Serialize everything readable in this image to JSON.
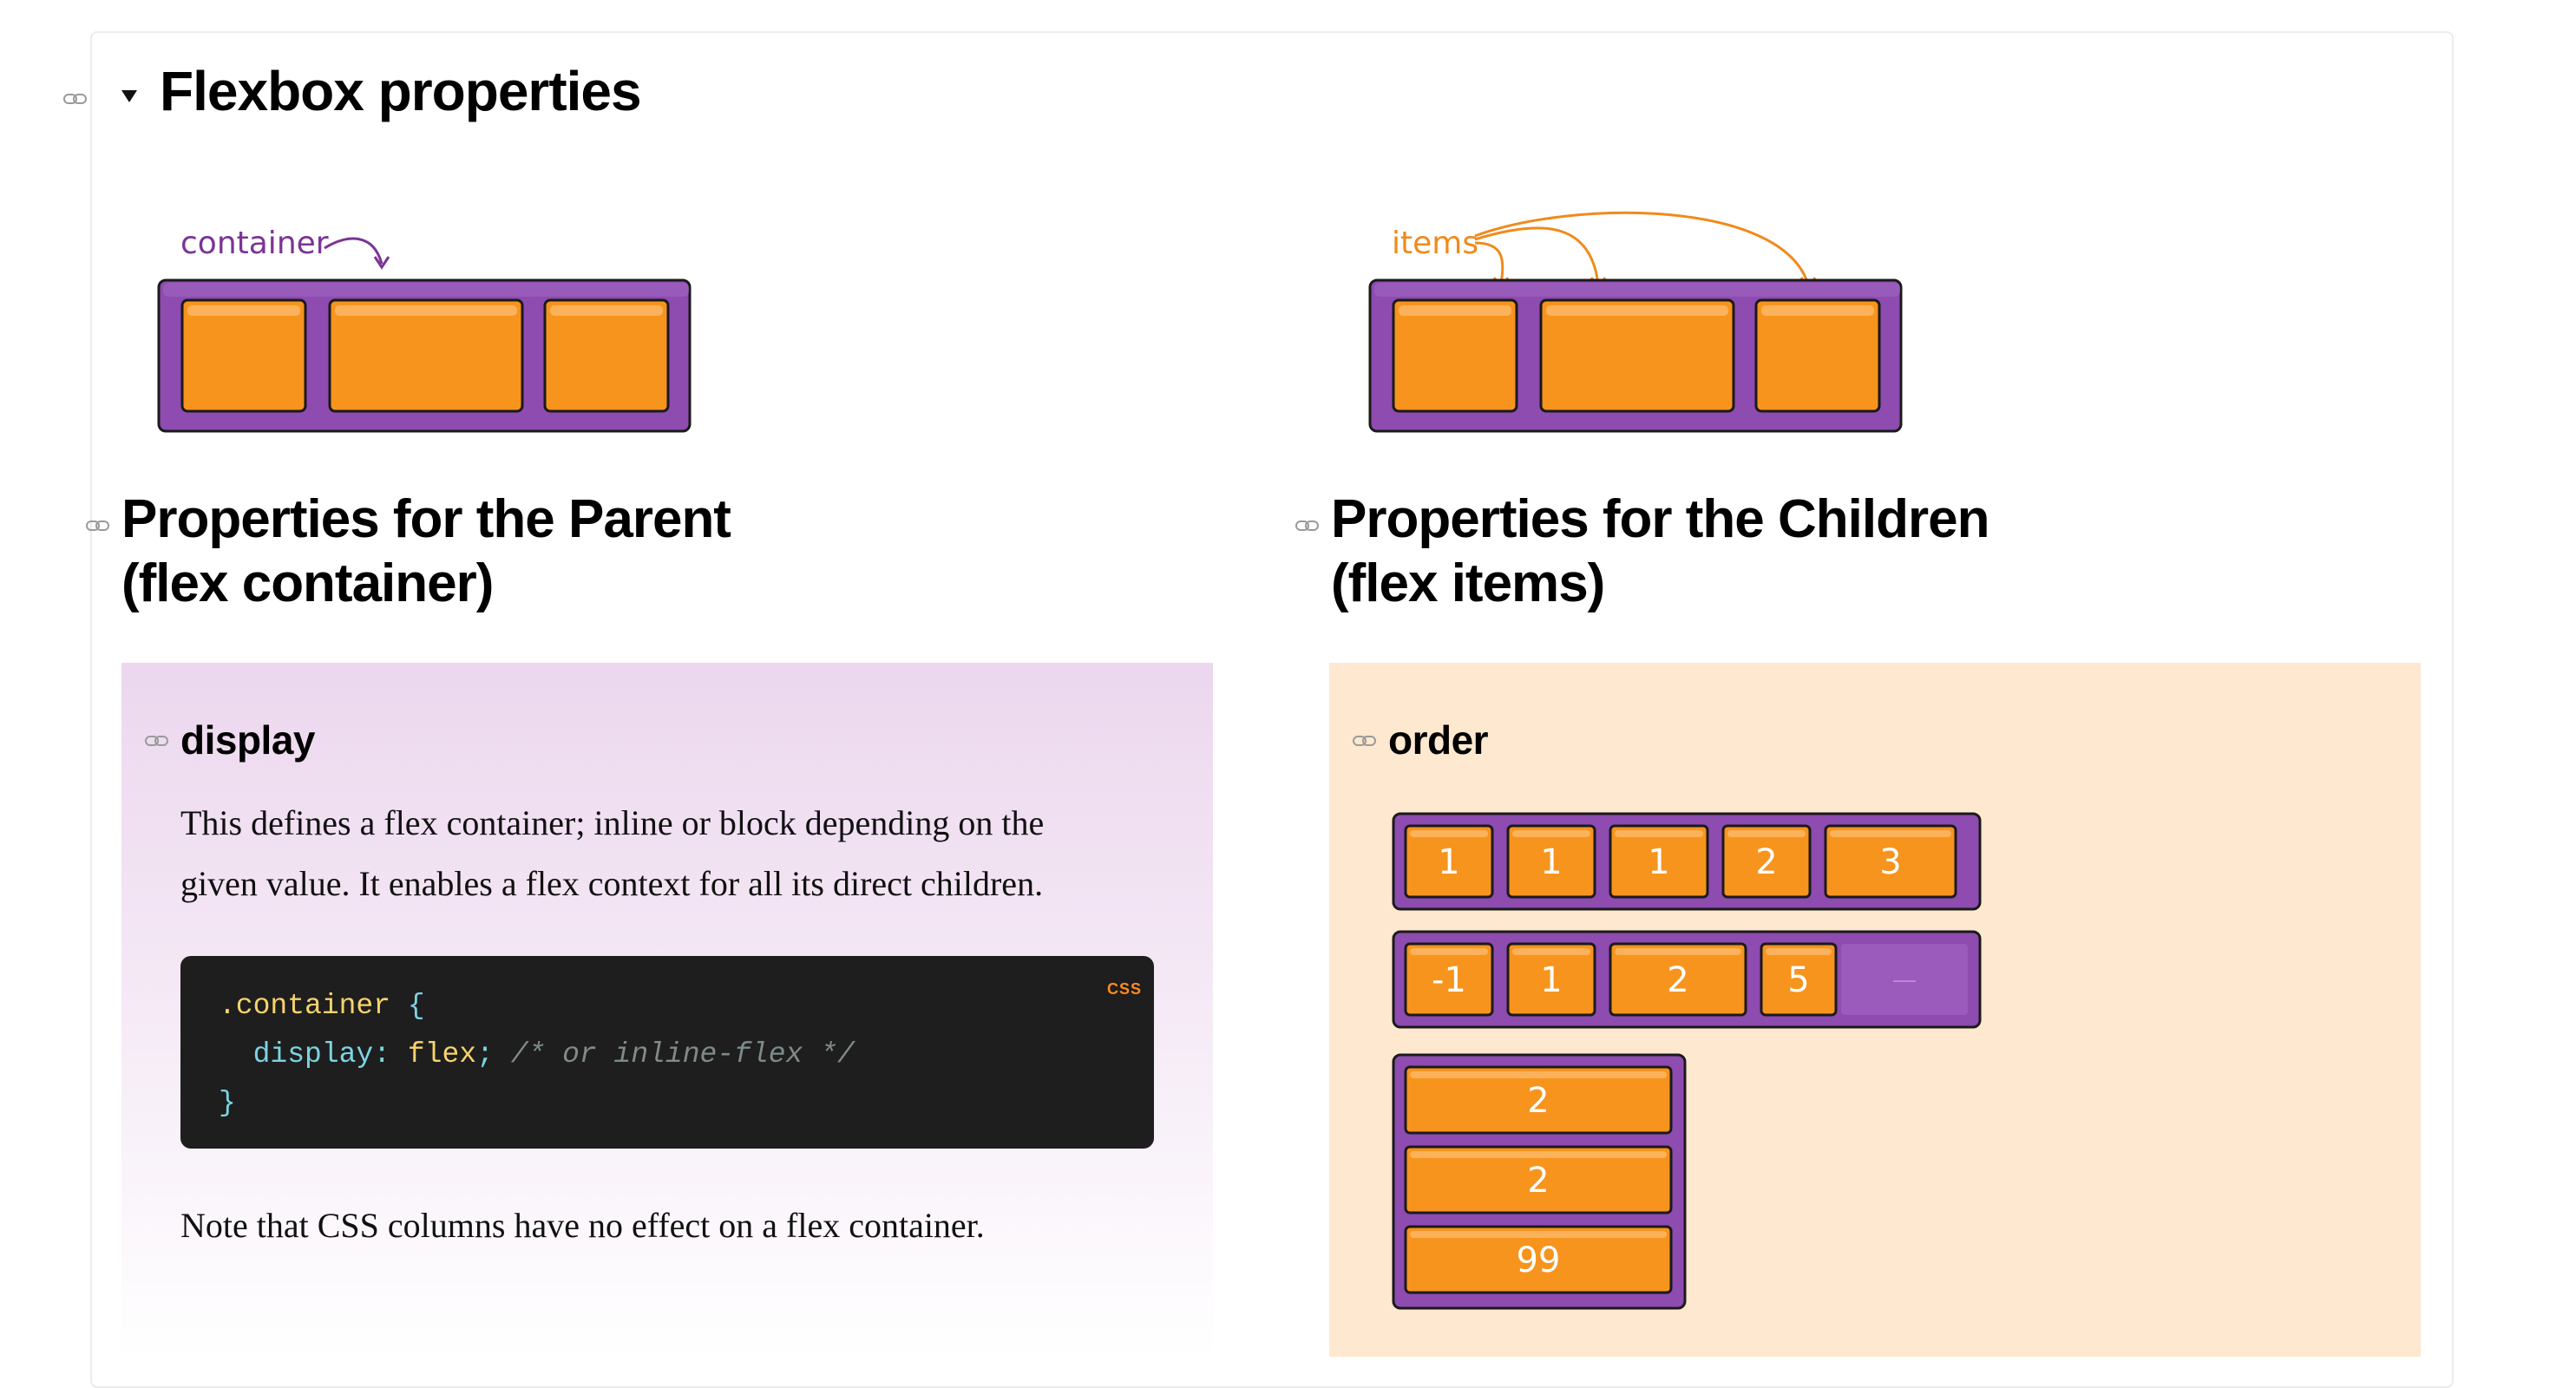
{
  "section": {
    "title": "Flexbox properties"
  },
  "illustrations": {
    "container_label": "container",
    "items_label": "items"
  },
  "parent_column": {
    "heading_line1": "Properties for the Parent",
    "heading_line2": "(flex container)"
  },
  "children_column": {
    "heading_line1": "Properties for the Children",
    "heading_line2": "(flex items)"
  },
  "display_block": {
    "heading": "display",
    "description_line1": "This defines a flex container; inline or block depending on the",
    "description_line2": "given value. It enables a flex context for all its direct children.",
    "code": {
      "language": "CSS",
      "selector": ".container",
      "open_brace": "{",
      "property": "display",
      "colon": ":",
      "value": "flex",
      "semicolon": ";",
      "comment": "/* or inline-flex */",
      "close_brace": "}"
    },
    "note": "Note that CSS columns have no effect on a flex container."
  },
  "order_block": {
    "heading": "order",
    "row1": [
      "1",
      "1",
      "1",
      "2",
      "3"
    ],
    "row2": [
      "-1",
      "1",
      "2",
      "5"
    ],
    "column": [
      "2",
      "2",
      "99"
    ]
  },
  "colors": {
    "purple": "#8e4bb0",
    "orange": "#f7941d",
    "label_purple": "#7a3595",
    "label_orange": "#f08a1c",
    "code_bg": "#1e1e1e"
  }
}
